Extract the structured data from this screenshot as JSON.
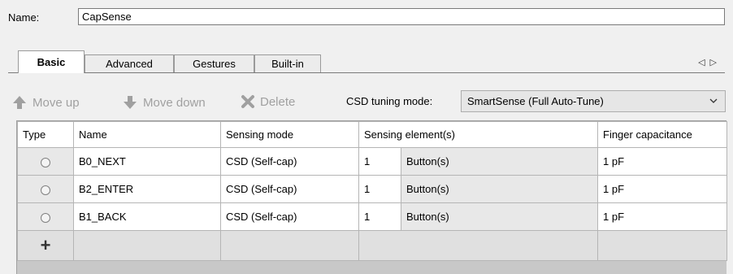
{
  "name_row": {
    "label": "Name:",
    "value": "CapSense"
  },
  "tabs": [
    {
      "label": "Basic",
      "active": true
    },
    {
      "label": "Advanced",
      "active": false
    },
    {
      "label": "Gestures",
      "active": false
    },
    {
      "label": "Built-in",
      "active": false
    }
  ],
  "tab_scroll": {
    "left": "◁",
    "right": "▷"
  },
  "toolbar": {
    "move_up": "Move up",
    "move_down": "Move down",
    "delete": "Delete",
    "tuning_label": "CSD tuning mode:",
    "tuning_value": "SmartSense (Full Auto-Tune)"
  },
  "table": {
    "headers": [
      "Type",
      "Name",
      "Sensing mode",
      "Sensing element(s)",
      "Finger capacitance"
    ],
    "rows": [
      {
        "name": "B0_NEXT",
        "mode": "CSD (Self-cap)",
        "count": "1",
        "element": "Button(s)",
        "capacitance": "1 pF"
      },
      {
        "name": "B2_ENTER",
        "mode": "CSD (Self-cap)",
        "count": "1",
        "element": "Button(s)",
        "capacitance": "1 pF"
      },
      {
        "name": "B1_BACK",
        "mode": "CSD (Self-cap)",
        "count": "1",
        "element": "Button(s)",
        "capacitance": "1 pF"
      }
    ],
    "add_symbol": "+"
  },
  "colors": {
    "disabled_text": "#a0a0a0",
    "grid_border": "#b5b5b5"
  }
}
